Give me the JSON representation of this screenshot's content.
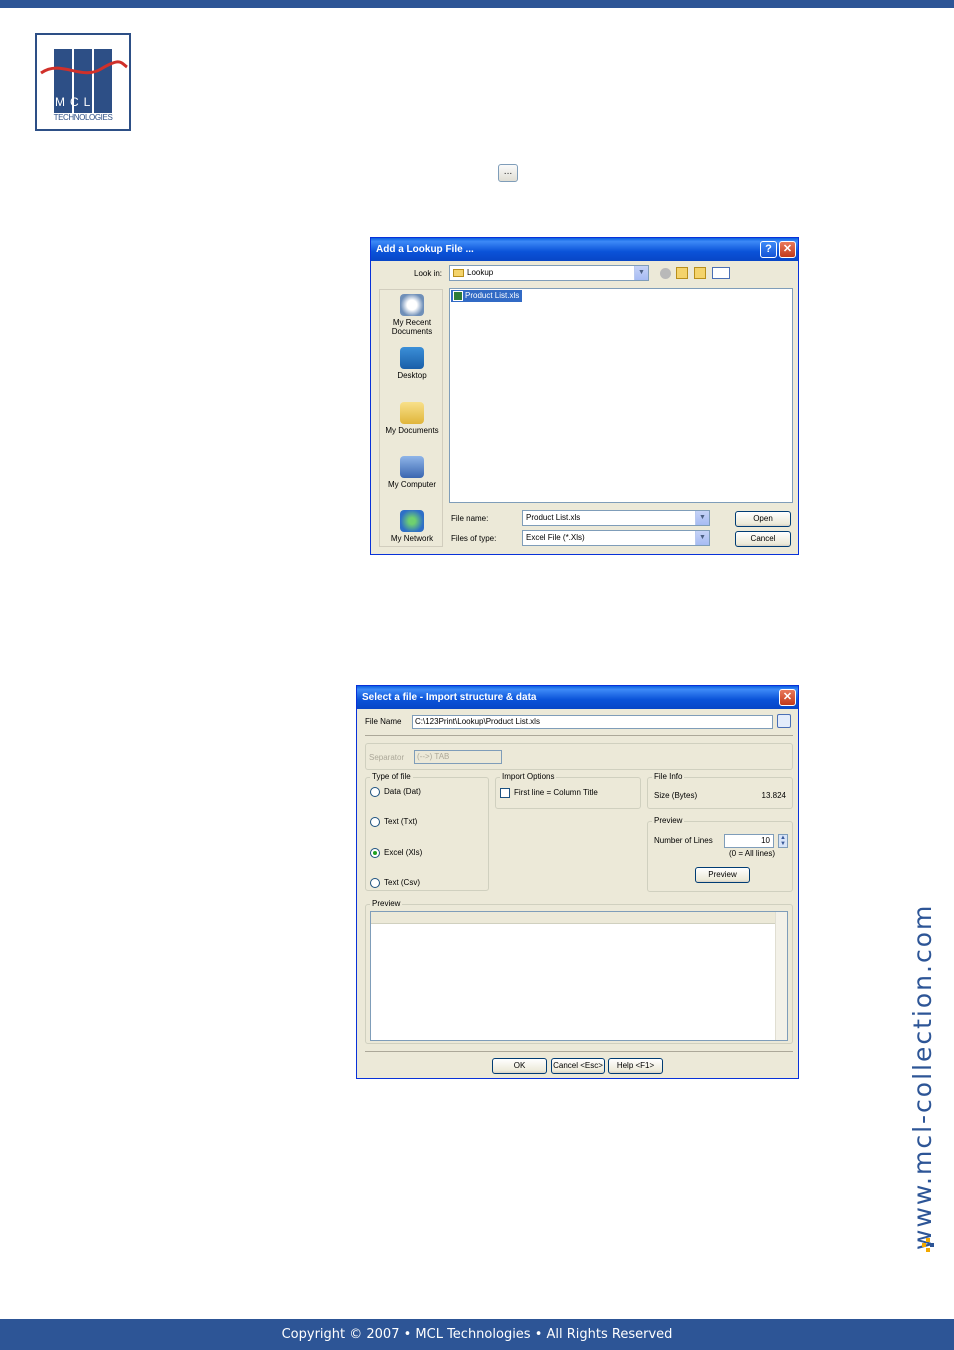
{
  "footer": {
    "copyright": "Copyright © 2007 • MCL Technologies • All Rights Reserved"
  },
  "logo": {
    "letters": "MCL",
    "subtitle": "TECHNOLOGIES"
  },
  "side": {
    "url": "www.mcl-collection.com"
  },
  "browse_mini": {
    "label": "..."
  },
  "lookup_dialog": {
    "title": "Add a Lookup File ...",
    "help_label": "?",
    "close_label": "✕",
    "look_in_label": "Look in:",
    "look_in_value": "Lookup",
    "places": [
      {
        "label": "My Recent Documents",
        "icon": "recent-documents-icon"
      },
      {
        "label": "Desktop",
        "icon": "desktop-icon"
      },
      {
        "label": "My Documents",
        "icon": "my-documents-icon"
      },
      {
        "label": "My Computer",
        "icon": "my-computer-icon"
      },
      {
        "label": "My Network",
        "icon": "my-network-icon"
      }
    ],
    "files": [
      {
        "name": "Product List.xls",
        "selected": true
      }
    ],
    "file_name_label": "File name:",
    "file_name_value": "Product List.xls",
    "file_type_label": "Files of type:",
    "file_type_value": "Excel File (*.Xls)",
    "open_label": "Open",
    "cancel_label": "Cancel"
  },
  "import_dialog": {
    "title": "Select a file - Import structure & data",
    "close_label": "✕",
    "file_name_label": "File Name",
    "file_name_value": "C:\\123Print\\Lookup\\Product List.xls",
    "separator_label": "Separator",
    "separator_value": "(-->) TAB",
    "type_group_label": "Type of file",
    "types": [
      {
        "label": "Data (Dat)",
        "checked": false
      },
      {
        "label": "Text (Txt)",
        "checked": false
      },
      {
        "label": "Excel (Xls)",
        "checked": true
      },
      {
        "label": "Text (Csv)",
        "checked": false
      }
    ],
    "import_group_label": "Import Options",
    "first_line_label": "First line = Column Title",
    "fileinfo_group_label": "File Info",
    "size_label": "Size (Bytes)",
    "size_value": "13.824",
    "preview_group_label": "Preview",
    "lines_label": "Number of Lines",
    "lines_value": "10",
    "lines_hint": "(0 = All lines)",
    "preview_button_label": "Preview",
    "preview_area_label": "Preview",
    "ok_label": "OK",
    "cancel_label": "Cancel <Esc>",
    "help_label": "Help <F1>"
  },
  "colors": {
    "brand_blue": "#2d5596",
    "xp_title": "#0a52d8",
    "dialog_bg": "#ece9d8"
  }
}
